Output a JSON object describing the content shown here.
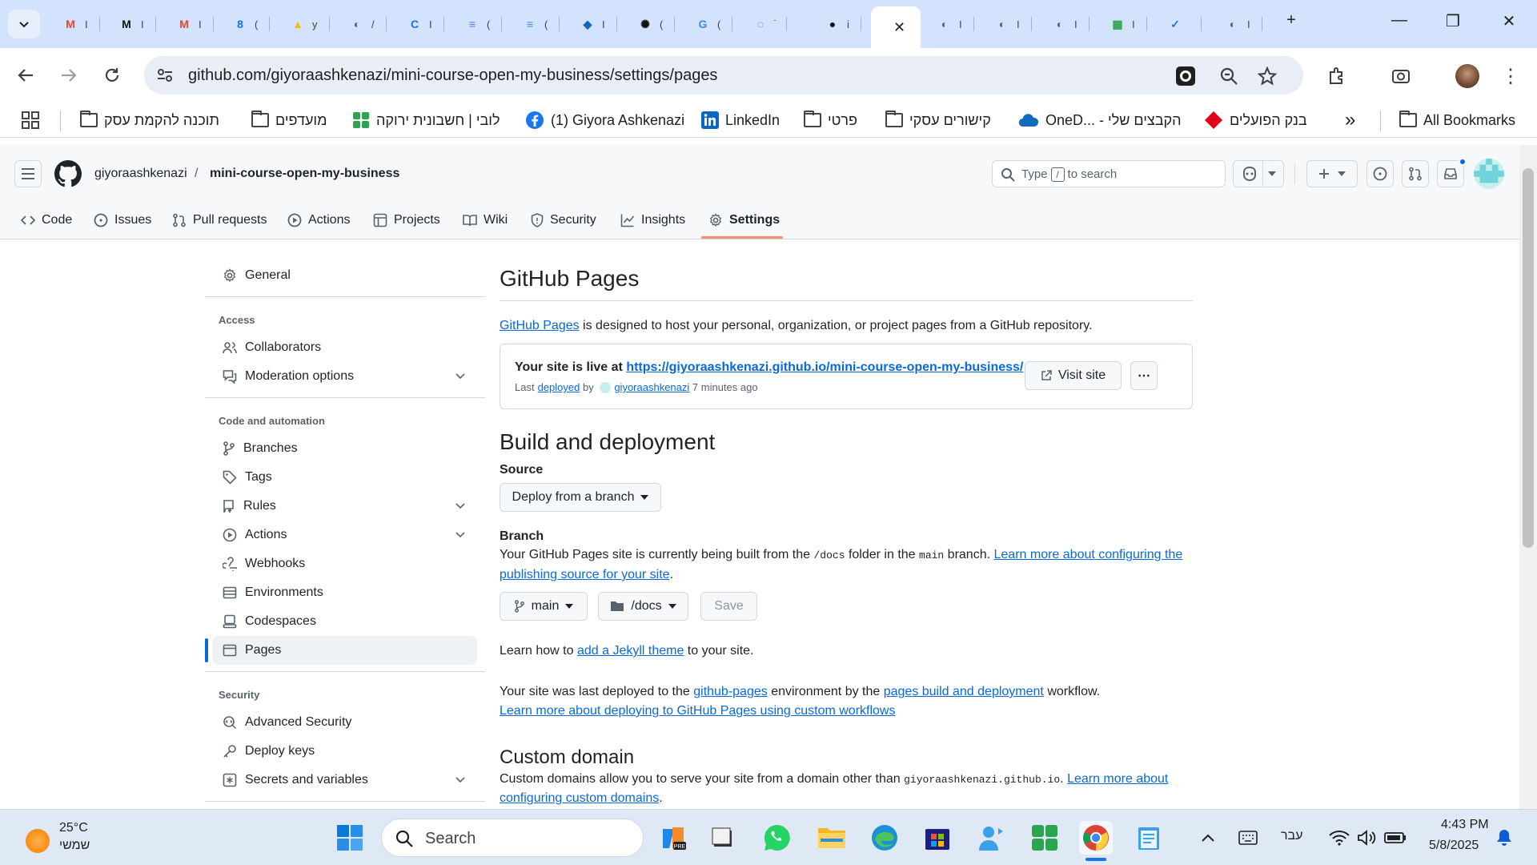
{
  "colors": {
    "tabstrip": "#d3e3fd",
    "link": "#0969da",
    "tab_underline": "#fd8c73",
    "active_side_bar": "#0969da"
  },
  "browser": {
    "url": "github.com/giyoraashkenazi/mini-course-open-my-business/settings/pages",
    "tabs": [
      {
        "icon": "gmail-icon",
        "title": "I"
      },
      {
        "icon": "m-icon",
        "title": "I"
      },
      {
        "icon": "gmail-icon",
        "title": "I"
      },
      {
        "icon": "calendar-icon",
        "title": "("
      },
      {
        "icon": "drive-icon",
        "title": "у"
      },
      {
        "icon": "globe-icon",
        "title": "/"
      },
      {
        "icon": "c-icon",
        "title": "I"
      },
      {
        "icon": "doc-icon",
        "title": "("
      },
      {
        "icon": "doc-icon",
        "title": "("
      },
      {
        "icon": "shape-icon",
        "title": "I"
      },
      {
        "icon": "openai-icon",
        "title": "("
      },
      {
        "icon": "translate-icon",
        "title": "("
      },
      {
        "icon": "drop-icon",
        "title": "ֿ"
      },
      {
        "icon": "github-icon",
        "title": "i"
      },
      {
        "icon": "globe-icon",
        "title": "I"
      },
      {
        "icon": "globe-icon",
        "title": "I"
      },
      {
        "icon": "globe-icon",
        "title": "I"
      },
      {
        "icon": "grid-icon",
        "title": "I"
      },
      {
        "icon": "check-icon",
        "title": ""
      },
      {
        "icon": "globe-icon",
        "title": "I"
      }
    ],
    "bookmarks": [
      {
        "icon": "folder-icon",
        "label": "תוכנה להקמת עסק"
      },
      {
        "icon": "folder-icon",
        "label": "מועדפים"
      },
      {
        "icon": "grid-icon",
        "label": "לובי | חשבונית ירוקה"
      },
      {
        "icon": "facebook-icon",
        "label": "(1) Giyora Ashkenazi"
      },
      {
        "icon": "linkedin-icon",
        "label": "LinkedIn"
      },
      {
        "icon": "folder-icon",
        "label": "פרטי"
      },
      {
        "icon": "folder-icon",
        "label": "קישורים עסקי"
      },
      {
        "icon": "onedrive-icon",
        "label": "OneD... - הקבצים שלי"
      },
      {
        "icon": "bank-icon",
        "label": "בנק הפועלים"
      }
    ],
    "more_bookmarks": "»",
    "all_bookmarks": "All Bookmarks"
  },
  "github": {
    "owner": "giyoraashkenazi",
    "sep": "/",
    "repo": "mini-course-open-my-business",
    "search_type": "Type",
    "search_slash": "/",
    "search_rest": "to search",
    "tabs": [
      {
        "icon": "code-icon",
        "label": "Code"
      },
      {
        "icon": "issue-icon",
        "label": "Issues"
      },
      {
        "icon": "pull-request-icon",
        "label": "Pull requests"
      },
      {
        "icon": "play-icon",
        "label": "Actions"
      },
      {
        "icon": "table-icon",
        "label": "Projects"
      },
      {
        "icon": "book-icon",
        "label": "Wiki"
      },
      {
        "icon": "shield-icon",
        "label": "Security"
      },
      {
        "icon": "graph-icon",
        "label": "Insights"
      },
      {
        "icon": "gear-icon",
        "label": "Settings"
      }
    ]
  },
  "sidebar": {
    "general": "General",
    "access_head": "Access",
    "collaborators": "Collaborators",
    "moderation": "Moderation options",
    "code_head": "Code and automation",
    "branches": "Branches",
    "tags": "Tags",
    "rules": "Rules",
    "actions": "Actions",
    "webhooks": "Webhooks",
    "environments": "Environments",
    "codespaces": "Codespaces",
    "pages": "Pages",
    "security_head": "Security",
    "advanced_security": "Advanced Security",
    "deploy_keys": "Deploy keys",
    "secrets": "Secrets and variables"
  },
  "main": {
    "title": "GitHub Pages",
    "intro_link": "GitHub Pages",
    "intro_rest": " is designed to host your personal, organization, or project pages from a GitHub repository.",
    "live_prefix": "Your site is live at ",
    "live_url": "https://giyoraashkenazi.github.io/mini-course-open-my-business/",
    "last": "Last ",
    "deployed": "deployed",
    "by": " by ",
    "user": "giyoraashkenazi",
    "ago": " 7 minutes ago",
    "visit_site": "Visit site",
    "more": "⋯",
    "build_title": "Build and deployment",
    "source_label": "Source",
    "source_value": "Deploy from a branch",
    "branch_label": "Branch",
    "branch_text_1": "Your GitHub Pages site is currently being built from the ",
    "branch_folder_code": "/docs",
    "branch_text_2": " folder in the ",
    "branch_main_code": "main",
    "branch_text_3": " branch. ",
    "branch_learn_1": "Learn more about configuring the",
    "branch_learn_2": "publishing source for your site",
    "period": ".",
    "branch_select": "main",
    "folder_select": "/docs",
    "save": "Save",
    "jekyll_pre": "Learn how to ",
    "jekyll_link": "add a Jekyll theme",
    "jekyll_post": " to your site.",
    "deployed_pre": "Your site was last deployed to the ",
    "env_link": "github-pages",
    "deployed_mid": " environment by the ",
    "workflow_link": "pages build and deployment",
    "deployed_post": " workflow.",
    "custom_workflow_link": "Learn more about deploying to GitHub Pages using custom workflows",
    "custom_domain_title": "Custom domain",
    "cd_pre": "Custom domains allow you to serve your site from a domain other than ",
    "cd_code": "giyoraashkenazi.github.io",
    "cd_link_1": "Learn more about",
    "cd_link_2": "configuring custom domains",
    "cd_period": "."
  },
  "taskbar": {
    "temp": "25°C",
    "weather_desc": "שמשי",
    "search": "Search",
    "lang": "עבר",
    "time": "4:43 PM",
    "date": "5/8/2025"
  }
}
